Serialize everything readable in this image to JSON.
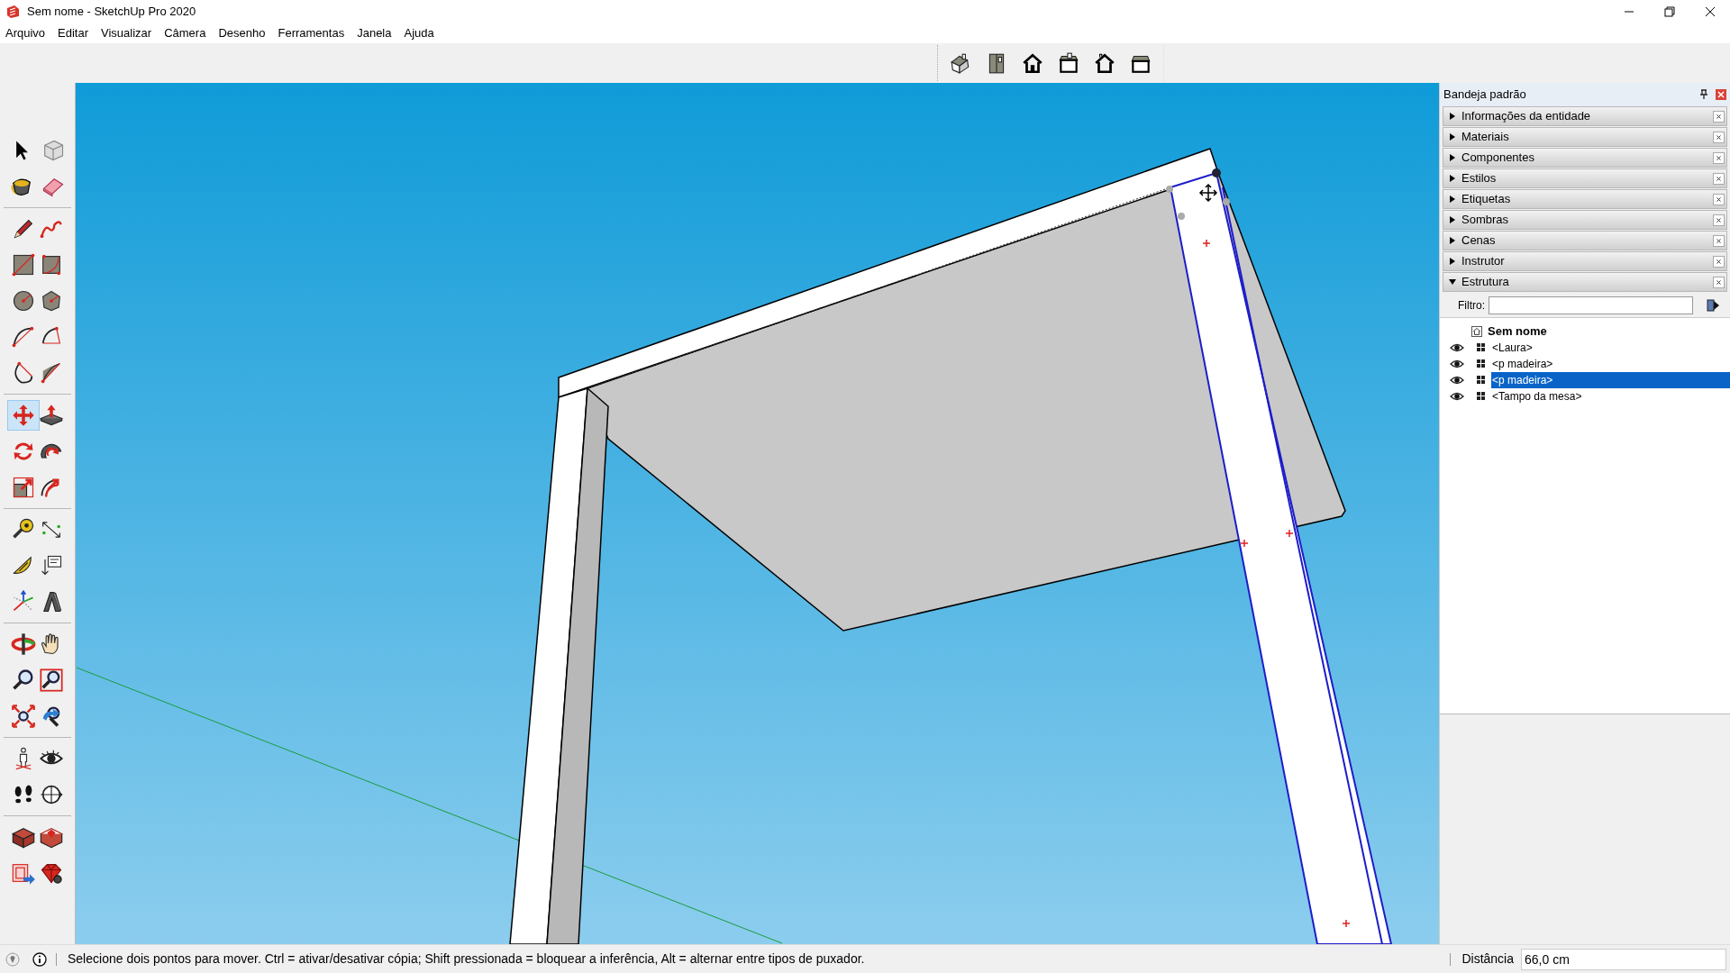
{
  "window": {
    "title": "Sem nome - SketchUp Pro 2020"
  },
  "menu": [
    "Arquivo",
    "Editar",
    "Visualizar",
    "Câmera",
    "Desenho",
    "Ferramentas",
    "Janela",
    "Ajuda"
  ],
  "view_toolbar": [
    {
      "kind": "iso"
    },
    {
      "kind": "top"
    },
    {
      "kind": "front"
    },
    {
      "kind": "right"
    },
    {
      "kind": "back"
    },
    {
      "kind": "left"
    }
  ],
  "tool_groups": [
    {
      "tools": [
        {
          "kind": "select",
          "selected": false
        },
        {
          "kind": "component",
          "selected": false
        },
        {
          "kind": "paint",
          "selected": false
        },
        {
          "kind": "eraser",
          "selected": false
        }
      ]
    },
    {
      "tools": [
        {
          "kind": "pencil",
          "selected": false
        },
        {
          "kind": "freehand",
          "selected": false
        },
        {
          "kind": "rectangle",
          "selected": false
        },
        {
          "kind": "rotated_rectangle",
          "selected": false
        },
        {
          "kind": "circle",
          "selected": false
        },
        {
          "kind": "polygon",
          "selected": false
        },
        {
          "kind": "arc",
          "selected": false
        },
        {
          "kind": "arc2",
          "selected": false
        },
        {
          "kind": "arc3",
          "selected": false
        },
        {
          "kind": "pie",
          "selected": false
        }
      ]
    },
    {
      "tools": [
        {
          "kind": "move",
          "selected": true
        },
        {
          "kind": "pushpull",
          "selected": false
        },
        {
          "kind": "rotate",
          "selected": false
        },
        {
          "kind": "followme",
          "selected": false
        },
        {
          "kind": "scale",
          "selected": false
        },
        {
          "kind": "offset",
          "selected": false
        }
      ]
    },
    {
      "tools": [
        {
          "kind": "tape",
          "selected": false
        },
        {
          "kind": "dimension",
          "selected": false
        },
        {
          "kind": "protractor",
          "selected": false
        },
        {
          "kind": "text",
          "selected": false
        },
        {
          "kind": "axes",
          "selected": false
        },
        {
          "kind": "text3d",
          "selected": false
        }
      ]
    },
    {
      "tools": [
        {
          "kind": "orbit",
          "selected": false
        },
        {
          "kind": "pan",
          "selected": false
        },
        {
          "kind": "zoom",
          "selected": false
        },
        {
          "kind": "zoomwindow",
          "selected": false
        },
        {
          "kind": "zoomextents",
          "selected": false
        },
        {
          "kind": "previous",
          "selected": false
        }
      ]
    },
    {
      "tools": [
        {
          "kind": "camera",
          "selected": false
        },
        {
          "kind": "lookaround",
          "selected": false
        },
        {
          "kind": "walk",
          "selected": false
        },
        {
          "kind": "section",
          "selected": false
        }
      ]
    },
    {
      "tools": [
        {
          "kind": "warehouse",
          "selected": false
        },
        {
          "kind": "extwarehouse",
          "selected": false
        },
        {
          "kind": "layout",
          "selected": false
        },
        {
          "kind": "extmanager",
          "selected": false
        }
      ]
    }
  ],
  "tray": {
    "title": "Bandeja padrão",
    "panels": [
      {
        "label": "Informações da entidade",
        "expanded": false
      },
      {
        "label": "Materiais",
        "expanded": false
      },
      {
        "label": "Componentes",
        "expanded": false
      },
      {
        "label": "Estilos",
        "expanded": false
      },
      {
        "label": "Etiquetas",
        "expanded": false
      },
      {
        "label": "Sombras",
        "expanded": false
      },
      {
        "label": "Cenas",
        "expanded": false
      },
      {
        "label": "Instrutor",
        "expanded": false
      },
      {
        "label": "Estrutura",
        "expanded": true
      }
    ],
    "filter_label": "Filtro:",
    "outliner": {
      "label": "Sem nome",
      "children": [
        {
          "label": "<Laura>",
          "visible": true,
          "selected": false
        },
        {
          "label": "<p madeira>",
          "visible": true,
          "selected": false
        },
        {
          "label": "<p madeira>",
          "visible": true,
          "selected": true
        },
        {
          "label": "<Tampo da mesa>",
          "visible": true,
          "selected": false
        }
      ]
    }
  },
  "status_bar": {
    "message": "Selecione dois pontos para mover. Ctrl = ativar/desativar cópia; Shift pressionada = bloquear a inferência, Alt = alternar entre tipos de puxador.",
    "measure_label": "Distância",
    "measure_value": "66,0 cm"
  }
}
